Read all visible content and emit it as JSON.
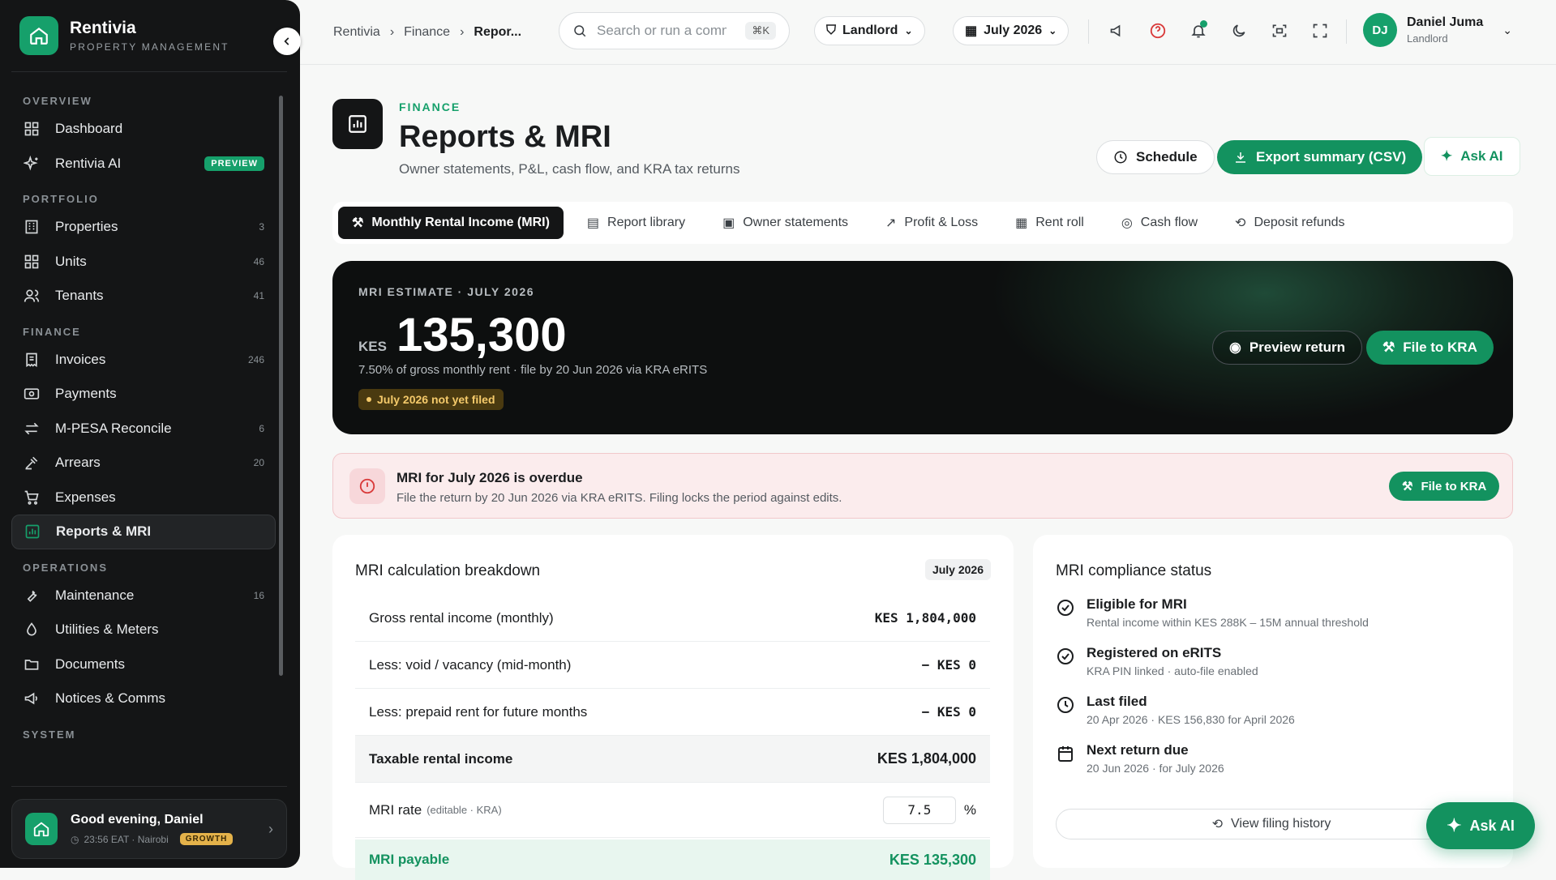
{
  "sidebar": {
    "brand": {
      "name": "Rentivia",
      "tagline": "PROPERTY MANAGEMENT"
    },
    "sections": [
      {
        "title": "OVERVIEW"
      },
      {
        "title": "PORTFOLIO"
      },
      {
        "title": "FINANCE"
      },
      {
        "title": "OPERATIONS"
      },
      {
        "title": "SYSTEM"
      }
    ],
    "items": {
      "dashboard": {
        "label": "Dashboard",
        "icon": "grid-icon"
      },
      "ai": {
        "label": "Rentivia AI",
        "icon": "sparkle-icon",
        "badge": "PREVIEW"
      },
      "properties": {
        "label": "Properties",
        "count": "3",
        "icon": "building-icon"
      },
      "units": {
        "label": "Units",
        "count": "46",
        "icon": "units-icon"
      },
      "tenants": {
        "label": "Tenants",
        "count": "41",
        "icon": "users-icon"
      },
      "invoices": {
        "label": "Invoices",
        "count": "246",
        "icon": "invoice-icon"
      },
      "payments": {
        "label": "Payments",
        "icon": "payment-icon"
      },
      "mpesa": {
        "label": "M-PESA Reconcile",
        "count": "6",
        "icon": "swap-icon"
      },
      "arrears": {
        "label": "Arrears",
        "count": "20",
        "icon": "gavel-icon"
      },
      "expenses": {
        "label": "Expenses",
        "icon": "cart-icon"
      },
      "reports": {
        "label": "Reports & MRI",
        "icon": "chart-icon"
      },
      "maintenance": {
        "label": "Maintenance",
        "count": "16",
        "icon": "wrench-icon"
      },
      "utilities": {
        "label": "Utilities & Meters",
        "icon": "drop-icon"
      },
      "documents": {
        "label": "Documents",
        "icon": "folder-icon"
      },
      "notices": {
        "label": "Notices & Comms",
        "icon": "megaphone-icon"
      }
    },
    "greeting": {
      "title": "Good evening, Daniel",
      "time": "23:56 EAT · Nairobi",
      "plan": "GROWTH"
    }
  },
  "topbar": {
    "breadcrumb": [
      "Rentivia",
      "Finance",
      "Repor..."
    ],
    "search_placeholder": "Search or run a command",
    "search_shortcut": "⌘K",
    "role": "Landlord",
    "period": "July 2026",
    "user": {
      "initials": "DJ",
      "name": "Daniel Juma",
      "role": "Landlord"
    }
  },
  "page": {
    "kicker": "FINANCE",
    "title": "Reports & MRI",
    "subtitle": "Owner statements, P&L, cash flow, and KRA tax returns",
    "actions": {
      "schedule": "Schedule",
      "export": "Export summary (CSV)",
      "ask_ai": "Ask AI"
    }
  },
  "tabs": [
    {
      "label": "Monthly Rental Income (MRI)",
      "active": true
    },
    {
      "label": "Report library"
    },
    {
      "label": "Owner statements"
    },
    {
      "label": "Profit & Loss"
    },
    {
      "label": "Rent roll"
    },
    {
      "label": "Cash flow"
    },
    {
      "label": "Deposit refunds"
    }
  ],
  "hero": {
    "label": "MRI ESTIMATE · JULY 2026",
    "currency": "KES",
    "amount": "135,300",
    "note": "7.50% of gross monthly rent · file by 20 Jun 2026 via KRA eRITS",
    "status": "July 2026 not yet filed",
    "preview_button": "Preview return",
    "file_button": "File to KRA"
  },
  "alert": {
    "title": "MRI for July 2026 is overdue",
    "text": "File the return by 20 Jun 2026 via KRA eRITS. Filing locks the period against edits.",
    "button": "File to KRA"
  },
  "breakdown": {
    "title": "MRI calculation breakdown",
    "period": "July 2026",
    "rows": [
      {
        "label": "Gross rental income (monthly)",
        "value": "KES 1,804,000"
      },
      {
        "label": "Less: void / vacancy (mid-month)",
        "value": "− KES 0"
      },
      {
        "label": "Less: prepaid rent for future months",
        "value": "− KES 0"
      },
      {
        "label": "Taxable rental income",
        "value": "KES 1,804,000"
      }
    ],
    "rate": {
      "label": "MRI rate",
      "hint": "(editable · KRA)",
      "value": "7.5",
      "unit": "%"
    },
    "payable": {
      "label": "MRI payable",
      "value": "KES 135,300"
    }
  },
  "compliance": {
    "title": "MRI compliance status",
    "items": [
      {
        "title": "Eligible for MRI",
        "sub": "Rental income within KES 288K – 15M annual threshold",
        "icon": "check-circle-icon"
      },
      {
        "title": "Registered on eRITS",
        "sub": "KRA PIN linked · auto-file enabled",
        "icon": "check-circle-icon"
      },
      {
        "title": "Last filed",
        "sub": "20 Apr 2026 · KES 156,830 for April 2026",
        "icon": "clock-icon"
      },
      {
        "title": "Next return due",
        "sub": "20 Jun 2026 · for July 2026",
        "icon": "calendar-icon"
      }
    ],
    "history_button": "View filing history"
  },
  "fab": {
    "label": "Ask AI"
  },
  "colors": {
    "accent": "#16a06b",
    "dark": "#141516",
    "alert_bg": "#fbeced"
  }
}
